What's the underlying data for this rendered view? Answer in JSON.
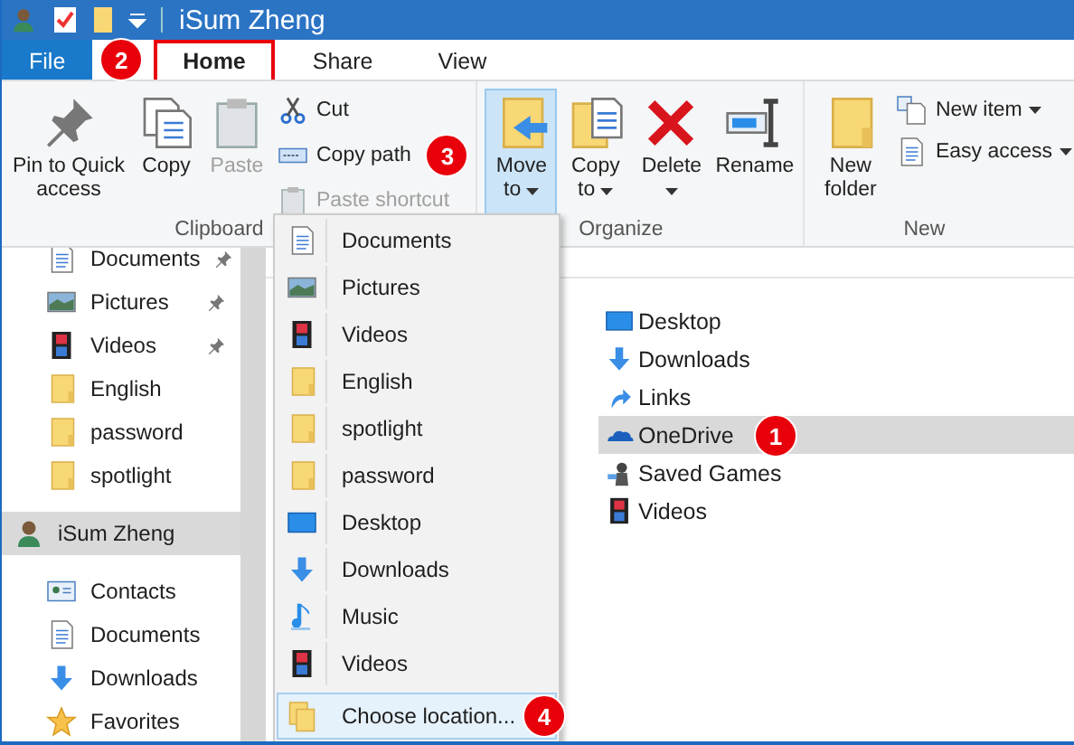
{
  "window": {
    "title": "iSum Zheng"
  },
  "ribbon_tabs": [
    {
      "label": "File",
      "kind": "file",
      "selected": false,
      "outlined": false
    },
    {
      "label": "Home",
      "kind": "tab",
      "selected": true,
      "outlined": true,
      "badge": "2"
    },
    {
      "label": "Share",
      "kind": "tab",
      "selected": false,
      "outlined": false
    },
    {
      "label": "View",
      "kind": "tab",
      "selected": false,
      "outlined": false
    }
  ],
  "ribbon_groups": [
    {
      "label": "Clipboard",
      "large": [
        {
          "label": "Pin to Quick access",
          "kind": "pin",
          "disabled": false,
          "pressed": false,
          "dropdown": false
        },
        {
          "label": "Copy",
          "kind": "copy",
          "disabled": false,
          "pressed": false,
          "dropdown": false
        },
        {
          "label": "Paste",
          "kind": "paste",
          "disabled": true,
          "pressed": false,
          "dropdown": false
        }
      ],
      "small": [
        {
          "label": "Cut",
          "kind": "cut",
          "disabled": false,
          "dropdown": false
        },
        {
          "label": "Copy path",
          "kind": "copypath",
          "disabled": false,
          "dropdown": false,
          "badge": "3"
        },
        {
          "label": "Paste shortcut",
          "kind": "pasteshortcut",
          "disabled": true,
          "dropdown": false
        }
      ]
    },
    {
      "label": "Organize",
      "large": [
        {
          "label": "Move to",
          "kind": "move",
          "disabled": false,
          "pressed": true,
          "dropdown": true
        },
        {
          "label": "Copy to",
          "kind": "copyto",
          "disabled": false,
          "pressed": false,
          "dropdown": true
        },
        {
          "label": "Delete",
          "kind": "delete",
          "disabled": false,
          "pressed": false,
          "dropdown": true
        },
        {
          "label": "Rename",
          "kind": "rename",
          "disabled": false,
          "pressed": false,
          "dropdown": false
        }
      ]
    },
    {
      "label": "New",
      "large": [
        {
          "label": "New folder",
          "kind": "folder",
          "disabled": false,
          "pressed": false,
          "dropdown": false
        }
      ],
      "small": [
        {
          "label": "New item",
          "kind": "newitem",
          "disabled": false,
          "dropdown": true
        },
        {
          "label": "Easy access",
          "kind": "easyaccess",
          "disabled": false,
          "dropdown": true
        }
      ]
    }
  ],
  "nav_pane": [
    {
      "label": "Documents",
      "kind": "documents",
      "pinned": true,
      "selected": false
    },
    {
      "label": "Pictures",
      "kind": "pictures",
      "pinned": true,
      "selected": false
    },
    {
      "label": "Videos",
      "kind": "videos",
      "pinned": true,
      "selected": false
    },
    {
      "label": "English",
      "kind": "folder",
      "pinned": false,
      "selected": false
    },
    {
      "label": "password",
      "kind": "folder",
      "pinned": false,
      "selected": false
    },
    {
      "label": "spotlight",
      "kind": "folder",
      "pinned": false,
      "selected": false
    },
    {
      "label": "iSum Zheng",
      "kind": "user",
      "pinned": false,
      "selected": true
    },
    {
      "label": "Contacts",
      "kind": "contacts",
      "pinned": false,
      "selected": false
    },
    {
      "label": "Documents",
      "kind": "documents",
      "pinned": false,
      "selected": false
    },
    {
      "label": "Downloads",
      "kind": "downloads",
      "pinned": false,
      "selected": false
    },
    {
      "label": "Favorites",
      "kind": "favorites",
      "pinned": false,
      "selected": false
    }
  ],
  "files": [
    {
      "label": "Desktop",
      "kind": "desktop",
      "selected": false
    },
    {
      "label": "Downloads",
      "kind": "downloads",
      "selected": false
    },
    {
      "label": "Links",
      "kind": "links",
      "selected": false
    },
    {
      "label": "OneDrive",
      "kind": "onedrive",
      "selected": true,
      "badge": "1"
    },
    {
      "label": "Saved Games",
      "kind": "games",
      "selected": false
    },
    {
      "label": "Videos",
      "kind": "videos",
      "selected": false
    }
  ],
  "move_to_menu": [
    {
      "label": "Documents",
      "kind": "documents",
      "selected": false
    },
    {
      "label": "Pictures",
      "kind": "pictures",
      "selected": false
    },
    {
      "label": "Videos",
      "kind": "videos",
      "selected": false
    },
    {
      "label": "English",
      "kind": "folder",
      "selected": false
    },
    {
      "label": "spotlight",
      "kind": "folder",
      "selected": false
    },
    {
      "label": "password",
      "kind": "folder",
      "selected": false
    },
    {
      "label": "Desktop",
      "kind": "desktop",
      "selected": false
    },
    {
      "label": "Downloads",
      "kind": "downloads",
      "selected": false
    },
    {
      "label": "Music",
      "kind": "music",
      "selected": false
    },
    {
      "label": "Videos",
      "kind": "videos",
      "selected": false
    },
    {
      "label": "Choose location...",
      "kind": "choose",
      "selected": true,
      "badge": "4"
    }
  ]
}
